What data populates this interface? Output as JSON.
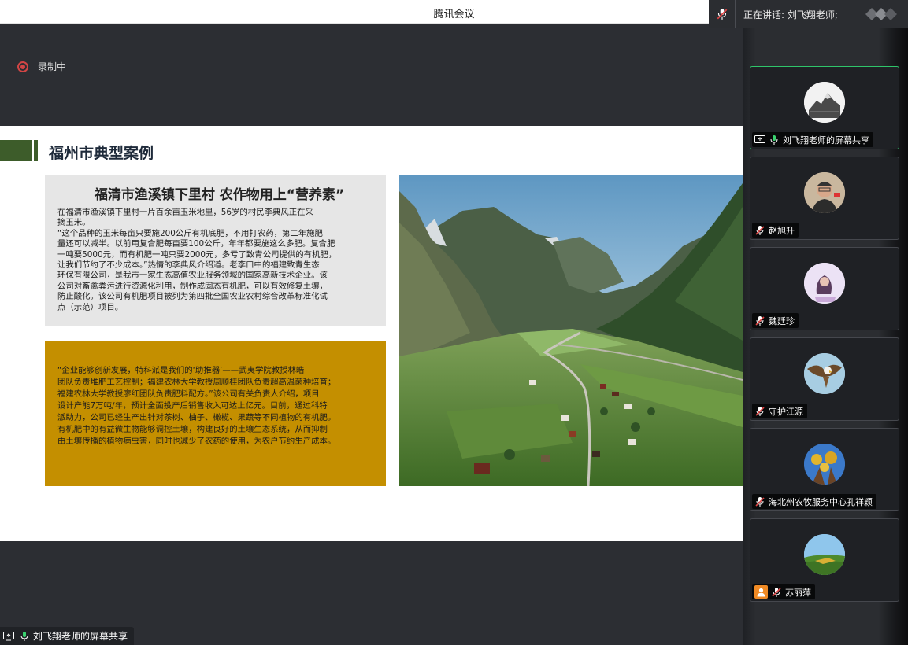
{
  "window": {
    "title": "腾讯会议"
  },
  "speaking": {
    "text": "正在讲话: 刘飞翔老师;"
  },
  "recording": {
    "label": "录制中"
  },
  "slide": {
    "heading": "福州市典型案例",
    "box1": {
      "title": "福清市渔溪镇下里村  农作物用上“营养素”",
      "lines": [
        "      在福清市渔溪镇下里村一片百余亩玉米地里，56岁的村民李典风正在采",
        "摘玉米。",
        "      “这个品种的玉米每亩只要施200公斤有机底肥，不用打农药，第二年施肥",
        "量还可以减半。以前用复合肥每亩要100公斤，年年都要施这么多肥。复合肥",
        "一吨要5000元，而有机肥一吨只要2000元，多亏了致青公司提供的有机肥，",
        "让我们节约了不少成本。”热情的李典风介绍道。老李口中的福建致青生态",
        "环保有限公司，是我市一家生态高值农业服务领域的国家高新技术企业。该",
        "公司对畜禽粪污进行资源化利用，制作成固态有机肥，可以有效修复土壤，",
        "防止酸化。该公司有机肥项目被列为第四批全国农业农村综合改革标准化试",
        "点（示范）项目。"
      ]
    },
    "box2": {
      "lines": [
        "        “企业能够创新发展，特科派是我们的‘助推器’——武夷学院教授林皓",
        "团队负责堆肥工艺控制；福建农林大学教授周顺桂团队负责超高温菌种培育；",
        "福建农林大学教授廖红团队负责肥料配方。”该公司有关负责人介绍，项目",
        "设计产能7万吨/年，预计全面投产后销售收入可达上亿元。目前，通过科特",
        "派助力，公司已经生产出针对茶树、柚子、橄榄、果蔬等不同植物的有机肥。",
        "有机肥中的有益微生物能够调控土壤，构建良好的土壤生态系统，从而抑制",
        "由土壤传播的植物病虫害，同时也减少了农药的使用，为农户节约生产成本。"
      ]
    }
  },
  "share_label": "刘飞翔老师的屏幕共享",
  "participants": [
    {
      "name": "刘飞翔老师的屏幕共享",
      "active": true,
      "mic": "on",
      "sharing": true
    },
    {
      "name": "赵旭升",
      "active": false,
      "mic": "muted"
    },
    {
      "name": "魏廷珍",
      "active": false,
      "mic": "muted"
    },
    {
      "name": "守护江源",
      "active": false,
      "mic": "muted"
    },
    {
      "name": "海北州农牧服务中心孔祥颖",
      "active": false,
      "mic": "muted"
    },
    {
      "name": "苏丽萍",
      "active": false,
      "mic": "muted",
      "badge": true
    }
  ],
  "colors": {
    "accent_green": "#3d5c2a",
    "box_gold": "#c48f00",
    "active_border": "#2fc56a",
    "record_red": "#d24545"
  },
  "icons": [
    "mic-muted-icon",
    "mic-on-icon",
    "screen-share-icon",
    "record-icon",
    "person-icon"
  ]
}
